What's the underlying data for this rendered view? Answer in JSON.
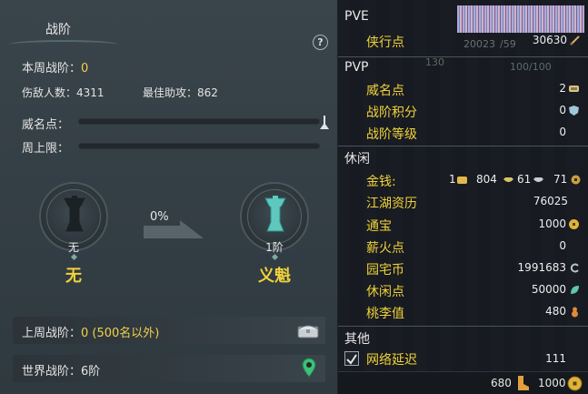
{
  "left": {
    "title": "战阶",
    "help": "?",
    "weekly_rank_label": "本周战阶：",
    "weekly_rank_value": "0",
    "kills_label": "伤敌人数：",
    "kills_value": "4311",
    "assist_label": "最佳助攻：",
    "assist_value": "862",
    "prestige_label": "威名点：",
    "weekly_cap_label": "周上限：",
    "current_medal": {
      "caption": "无",
      "name": "无"
    },
    "progress_pct": "0%",
    "next_medal": {
      "caption": "1阶",
      "name": "义魁"
    },
    "last_rank_label": "上周战阶：",
    "last_rank_value": "0 (500名以外)",
    "world_rank_label": "世界战阶：",
    "world_rank_value": "6阶"
  },
  "right": {
    "pve": {
      "head": "PVE",
      "rows": [
        {
          "label": "侠行点",
          "value": "30630",
          "icon": "sword-icon"
        }
      ]
    },
    "bg_text": {
      "a": "20023",
      "b": "/59",
      "c": "130",
      "d": "100/100"
    },
    "pvp": {
      "head": "PVP",
      "rows": [
        {
          "label": "威名点",
          "value": "2",
          "icon": "scroll-icon"
        },
        {
          "label": "战阶积分",
          "value": "0",
          "icon": "shield-icon"
        },
        {
          "label": "战阶等级",
          "value": "0",
          "icon": ""
        }
      ]
    },
    "leisure": {
      "head": "休闲",
      "money_label": "金钱:",
      "money": {
        "gold": "1",
        "silver_big": "804",
        "silver": "61",
        "copper": "71"
      },
      "rows": [
        {
          "label": "江湖资历",
          "value": "76025",
          "icon": ""
        },
        {
          "label": "通宝",
          "value": "1000",
          "icon": "coin-icon"
        },
        {
          "label": "薪火点",
          "value": "0",
          "icon": ""
        },
        {
          "label": "园宅币",
          "value": "1991683",
          "icon": "swirl-icon"
        },
        {
          "label": "休闲点",
          "value": "50000",
          "icon": "leaf-icon"
        },
        {
          "label": "桃李值",
          "value": "480",
          "icon": "gourd-icon"
        }
      ]
    },
    "other": {
      "head": "其他",
      "latency_label": "网络延迟",
      "latency_value": "111"
    },
    "bottom": {
      "value_a": "680",
      "value_b": "1000"
    }
  },
  "colors": {
    "accent_yellow": "#f0d23a",
    "panel": "#353f46",
    "right_bg": "#141a22"
  }
}
